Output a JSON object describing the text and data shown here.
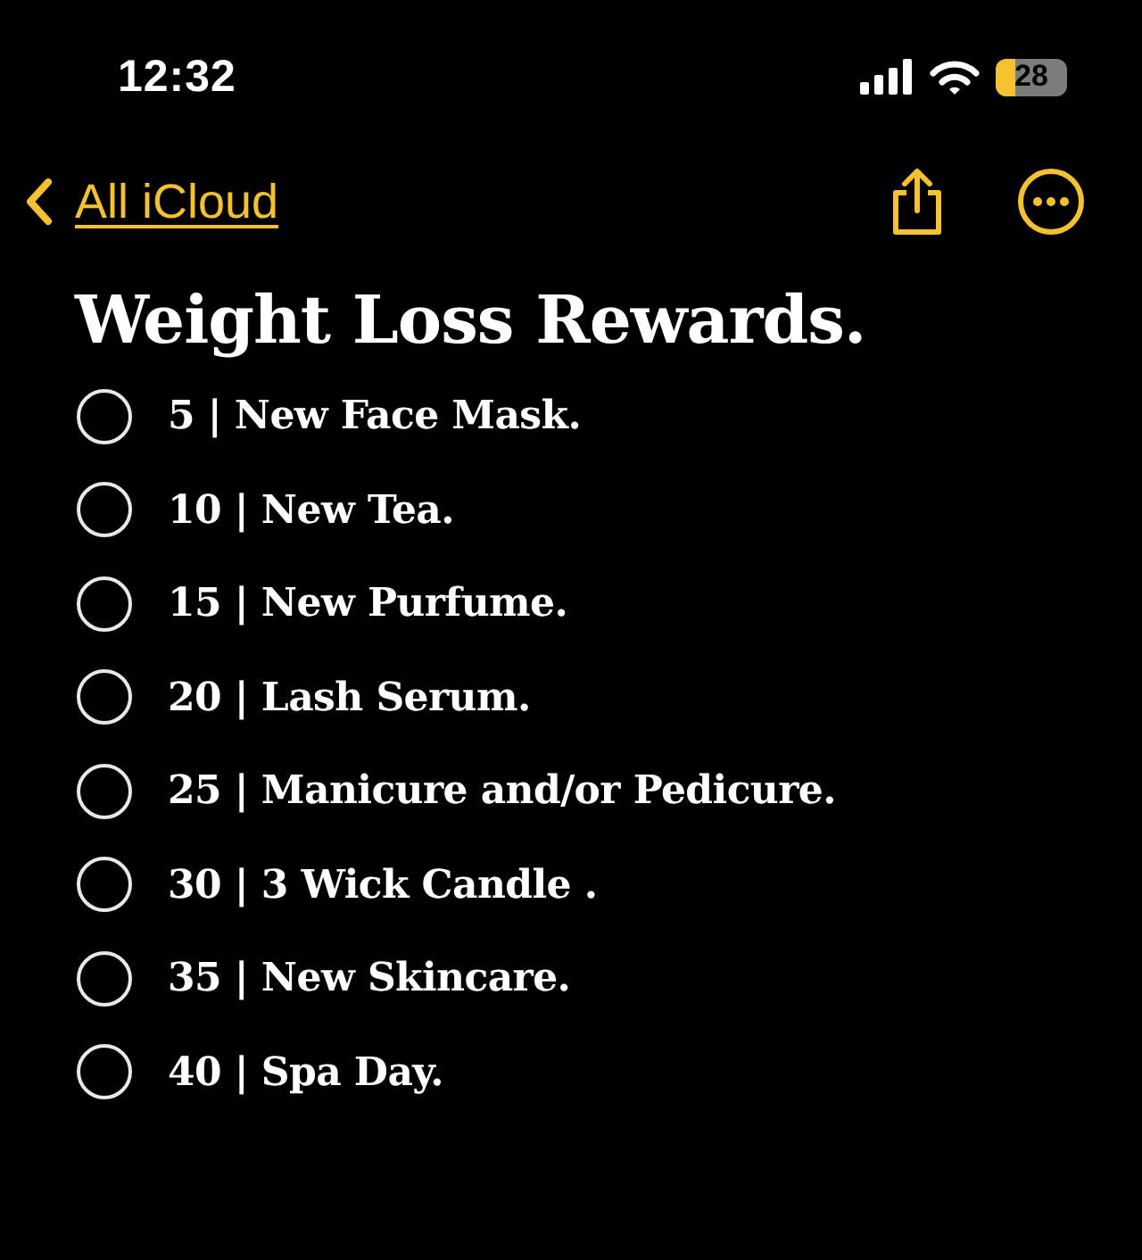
{
  "status_bar": {
    "time": "12:32",
    "battery": "28"
  },
  "nav": {
    "back_label": "All iCloud"
  },
  "note": {
    "title": "Weight Loss Rewards.",
    "checklist": [
      {
        "text": "5 | New Face Mask.",
        "checked": false
      },
      {
        "text": "10 | New Tea.",
        "checked": false
      },
      {
        "text": "15 | New Purfume.",
        "checked": false
      },
      {
        "text": "20 | Lash Serum.",
        "checked": false
      },
      {
        "text": "25 | Manicure and/or Pedicure.",
        "checked": false
      },
      {
        "text": "30 | 3 Wick Candle .",
        "checked": false
      },
      {
        "text": "35 | New Skincare.",
        "checked": false
      },
      {
        "text": "40 | Spa Day.",
        "checked": false
      }
    ]
  }
}
